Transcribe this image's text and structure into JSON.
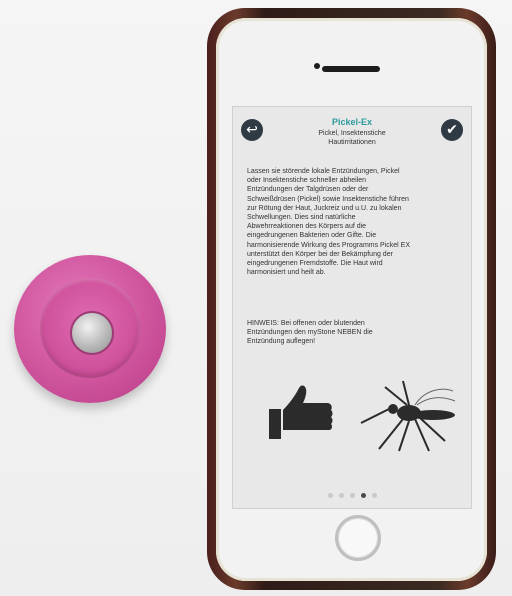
{
  "scene": {
    "object_device": "pink disc",
    "object_phone": "smartphone"
  },
  "app": {
    "title": "Pickel-Ex",
    "subtitle": "Pickel, Insektenstiche\nHautirritationen",
    "body": "Lassen sie störende lokale Entzündungen, Pickel\noder Insektenstiche schneller abheilen\nEntzündungen der Talgdrüsen oder der\nSchweißdrüsen (Pickel) sowie Insektenstiche führen\nzur Rötung der Haut, Juckreiz und u.U. zu lokalen\nSchwellungen. Dies sind natürliche\nAbwehrreaktionen des Körpers auf die\neingedrungenen Bakterien oder Gifte. Die\nharmonisierende Wirkung des Programms Pickel EX\nunterstützt den Körper bei der Bekämpfung der\neingedrungenen Fremdstoffe. Die Haut wird\nharmonisiert und heilt ab.",
    "note": "HINWEIS: Bei offenen oder blutenden\nEntzündungen den myStone NEBEN die\nEntzündung auflegen!",
    "back_icon": "back-arrow-icon",
    "confirm_icon": "checkmark-icon",
    "pager_count": 5,
    "pager_active_index": 3
  },
  "colors": {
    "device_pink": "#d1579f",
    "title_teal": "#2e9b9c",
    "button_dark": "#2f3a45",
    "screen_bg": "#e8e8e8"
  }
}
